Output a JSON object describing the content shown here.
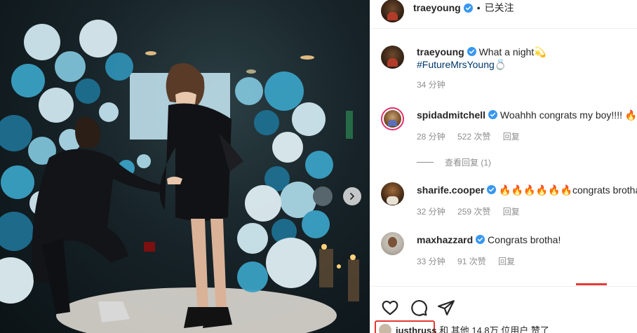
{
  "header": {
    "username": "traeyoung",
    "separator": "•",
    "follow_status": "已关注"
  },
  "comments": [
    {
      "username": "traeyoung",
      "text": "What a night",
      "emoji": "💫",
      "hashtag": "#FutureMrsYoung",
      "hashtag_emoji": "💍",
      "time": "34 分钟"
    },
    {
      "username": "spidadmitchell",
      "text": "Woahhh congrats my boy!!!! 🔥",
      "time": "28 分钟",
      "likes": "522 次赞",
      "reply": "回复",
      "view_replies": "查看回复 (1)"
    },
    {
      "username": "sharife.cooper",
      "text": "🔥🔥🔥🔥🔥🔥congrats brotha !",
      "time": "32 分钟",
      "likes": "259 次赞",
      "reply": "回复"
    },
    {
      "username": "maxhazzard",
      "text": "Congrats brotha!",
      "time": "33 分钟",
      "likes": "91 次赞",
      "reply": "回复"
    }
  ],
  "liked_by": {
    "username": "justhruss",
    "text": "和 其他 14.8万 位用户 赞了"
  },
  "icons": {
    "like": "heart-icon",
    "comment": "comment-icon",
    "share": "share-icon",
    "verified": "verified-badge-icon",
    "next": "chevron-right-icon"
  },
  "colors": {
    "verified": "#3897f0",
    "hashtag": "#00376b",
    "meta": "#8e8e8e",
    "highlight": "#e53935"
  }
}
